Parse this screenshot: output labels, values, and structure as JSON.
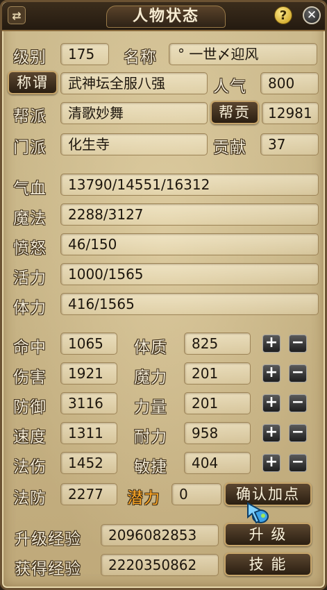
{
  "window": {
    "title": "人物状态",
    "help_icon": "?",
    "close_icon": "✕",
    "toggle_icon": "⇄"
  },
  "identity": {
    "level_label": "级别",
    "level_value": "175",
    "name_label": "名称",
    "name_value": "° 一世〆迎风",
    "title_button": "称谓",
    "title_value": "武神坛全服八强",
    "popularity_label": "人气",
    "popularity_value": "800",
    "gang_label": "帮派",
    "gang_value": "清歌妙舞",
    "gang_contrib_button": "帮贡",
    "gang_contrib_value": "12981",
    "school_label": "门派",
    "school_value": "化生寺",
    "contribution_label": "贡献",
    "contribution_value": "37"
  },
  "vitals": [
    {
      "label": "气血",
      "value": "13790/14551/16312"
    },
    {
      "label": "魔法",
      "value": "2288/3127"
    },
    {
      "label": "愤怒",
      "value": "46/150"
    },
    {
      "label": "活力",
      "value": "1000/1565"
    },
    {
      "label": "体力",
      "value": "416/1565"
    }
  ],
  "combat_stats": [
    {
      "label": "命中",
      "value": "1065"
    },
    {
      "label": "伤害",
      "value": "1921"
    },
    {
      "label": "防御",
      "value": "3116"
    },
    {
      "label": "速度",
      "value": "1311"
    },
    {
      "label": "法伤",
      "value": "1452"
    },
    {
      "label": "法防",
      "value": "2277"
    }
  ],
  "attributes": [
    {
      "label": "体质",
      "value": "825"
    },
    {
      "label": "魔力",
      "value": "201"
    },
    {
      "label": "力量",
      "value": "201"
    },
    {
      "label": "耐力",
      "value": "958"
    },
    {
      "label": "敏捷",
      "value": "404"
    }
  ],
  "buttons": {
    "plus": "+",
    "minus": "−",
    "confirm": "确认加点",
    "upgrade": "升 级",
    "skills": "技 能"
  },
  "potential": {
    "label": "潜力",
    "value": "0"
  },
  "experience": {
    "upgrade_label": "升级经验",
    "upgrade_value": "2096082853",
    "gained_label": "获得经验",
    "gained_value": "2220350862"
  }
}
